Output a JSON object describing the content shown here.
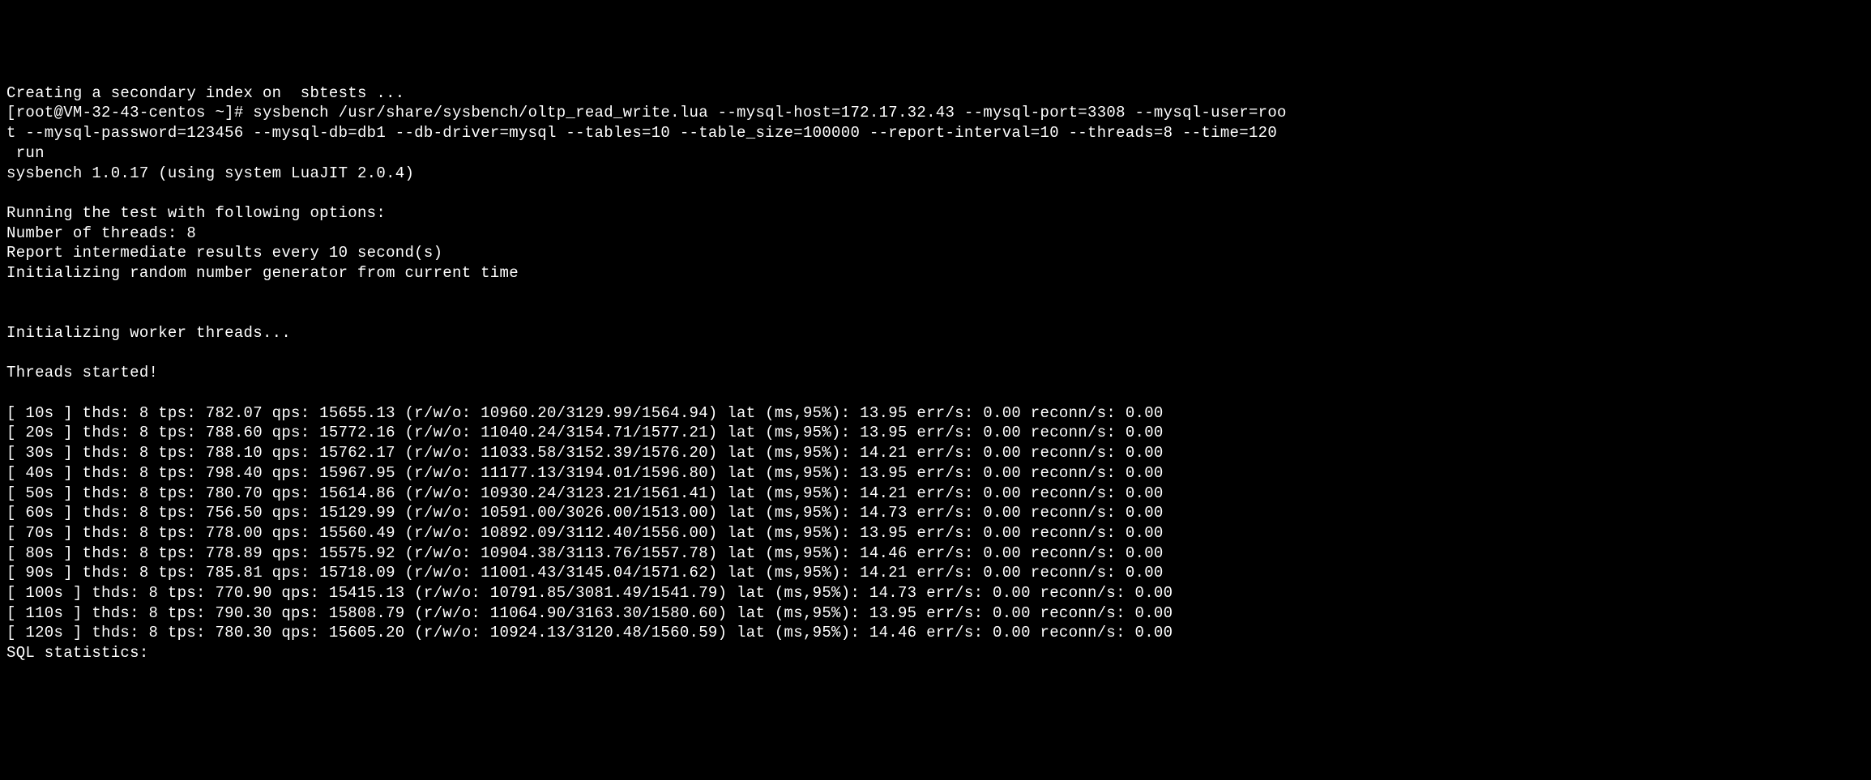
{
  "header_partial": "Creating a secondary index on  sbtests ...",
  "prompt": "[root@VM-32-43-centos ~]# ",
  "command_line1": "sysbench /usr/share/sysbench/oltp_read_write.lua --mysql-host=172.17.32.43 --mysql-port=3308 --mysql-user=roo",
  "command_line2": "t --mysql-password=123456 --mysql-db=db1 --db-driver=mysql --tables=10 --table_size=100000 --report-interval=10 --threads=8 --time=120",
  "command_line3": " run",
  "version_line": "sysbench 1.0.17 (using system LuaJIT 2.0.4)",
  "running_options": "Running the test with following options:",
  "threads_line": "Number of threads: 8",
  "report_interval": "Report intermediate results every 10 second(s)",
  "init_random": "Initializing random number generator from current time",
  "init_workers": "Initializing worker threads...",
  "threads_started": "Threads started!",
  "results": [
    "[ 10s ] thds: 8 tps: 782.07 qps: 15655.13 (r/w/o: 10960.20/3129.99/1564.94) lat (ms,95%): 13.95 err/s: 0.00 reconn/s: 0.00",
    "[ 20s ] thds: 8 tps: 788.60 qps: 15772.16 (r/w/o: 11040.24/3154.71/1577.21) lat (ms,95%): 13.95 err/s: 0.00 reconn/s: 0.00",
    "[ 30s ] thds: 8 tps: 788.10 qps: 15762.17 (r/w/o: 11033.58/3152.39/1576.20) lat (ms,95%): 14.21 err/s: 0.00 reconn/s: 0.00",
    "[ 40s ] thds: 8 tps: 798.40 qps: 15967.95 (r/w/o: 11177.13/3194.01/1596.80) lat (ms,95%): 13.95 err/s: 0.00 reconn/s: 0.00",
    "[ 50s ] thds: 8 tps: 780.70 qps: 15614.86 (r/w/o: 10930.24/3123.21/1561.41) lat (ms,95%): 14.21 err/s: 0.00 reconn/s: 0.00",
    "[ 60s ] thds: 8 tps: 756.50 qps: 15129.99 (r/w/o: 10591.00/3026.00/1513.00) lat (ms,95%): 14.73 err/s: 0.00 reconn/s: 0.00",
    "[ 70s ] thds: 8 tps: 778.00 qps: 15560.49 (r/w/o: 10892.09/3112.40/1556.00) lat (ms,95%): 13.95 err/s: 0.00 reconn/s: 0.00",
    "[ 80s ] thds: 8 tps: 778.89 qps: 15575.92 (r/w/o: 10904.38/3113.76/1557.78) lat (ms,95%): 14.46 err/s: 0.00 reconn/s: 0.00",
    "[ 90s ] thds: 8 tps: 785.81 qps: 15718.09 (r/w/o: 11001.43/3145.04/1571.62) lat (ms,95%): 14.21 err/s: 0.00 reconn/s: 0.00",
    "[ 100s ] thds: 8 tps: 770.90 qps: 15415.13 (r/w/o: 10791.85/3081.49/1541.79) lat (ms,95%): 14.73 err/s: 0.00 reconn/s: 0.00",
    "[ 110s ] thds: 8 tps: 790.30 qps: 15808.79 (r/w/o: 11064.90/3163.30/1580.60) lat (ms,95%): 13.95 err/s: 0.00 reconn/s: 0.00",
    "[ 120s ] thds: 8 tps: 780.30 qps: 15605.20 (r/w/o: 10924.13/3120.48/1560.59) lat (ms,95%): 14.46 err/s: 0.00 reconn/s: 0.00"
  ],
  "sql_stats": "SQL statistics:"
}
